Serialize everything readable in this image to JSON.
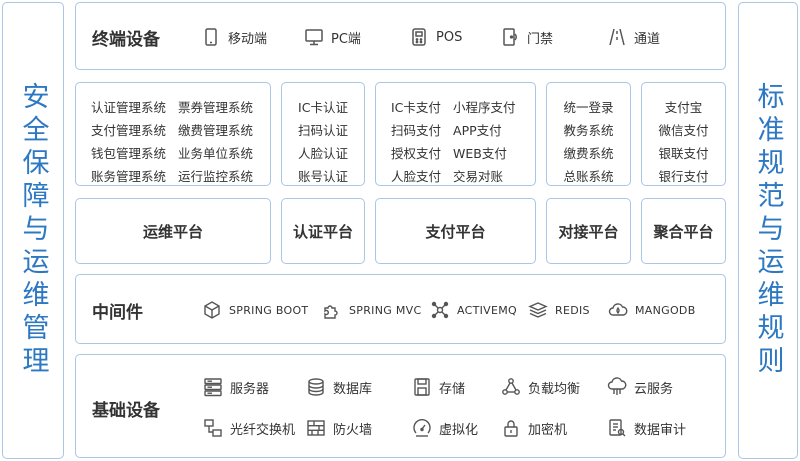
{
  "left_label": "安全保障与运维管理",
  "right_label": "标准规范与运维规则",
  "terminal": {
    "title": "终端设备",
    "items": [
      {
        "label": "移动端",
        "icon": "mobile-icon"
      },
      {
        "label": "PC端",
        "icon": "monitor-icon"
      },
      {
        "label": "POS",
        "icon": "pos-icon"
      },
      {
        "label": "门禁",
        "icon": "door-access-icon"
      },
      {
        "label": "通道",
        "icon": "passage-icon"
      }
    ]
  },
  "systems": {
    "mgmt": [
      "认证管理系统",
      "票券管理系统",
      "支付管理系统",
      "缴费管理系统",
      "钱包管理系统",
      "业务单位系统",
      "账务管理系统",
      "运行监控系统"
    ],
    "auth": [
      "IC卡认证",
      "扫码认证",
      "人脸认证",
      "账号认证"
    ],
    "pay": [
      "IC卡支付",
      "小程序支付",
      "扫码支付",
      "APP支付",
      "授权支付",
      "WEB支付",
      "人脸支付",
      "交易对账"
    ],
    "dock": [
      "统一登录",
      "教务系统",
      "缴费系统",
      "总账系统"
    ],
    "agg": [
      "支付宝",
      "微信支付",
      "银联支付",
      "银行支付"
    ]
  },
  "platforms": [
    "运维平台",
    "认证平台",
    "支付平台",
    "对接平台",
    "聚合平台"
  ],
  "middleware": {
    "title": "中间件",
    "items": [
      {
        "label": "SPRING BOOT",
        "icon": "cube-icon"
      },
      {
        "label": "SPRING MVC",
        "icon": "puzzle-icon"
      },
      {
        "label": "ACTIVEMQ",
        "icon": "network-nodes-icon"
      },
      {
        "label": "REDIS",
        "icon": "layers-icon"
      },
      {
        "label": "MANGODB",
        "icon": "cloud-leaf-icon"
      }
    ]
  },
  "infra": {
    "title": "基础设备",
    "items": [
      {
        "label": "服务器",
        "icon": "server-icon"
      },
      {
        "label": "数据库",
        "icon": "database-icon"
      },
      {
        "label": "存储",
        "icon": "storage-icon"
      },
      {
        "label": "负载均衡",
        "icon": "load-balance-icon"
      },
      {
        "label": "云服务",
        "icon": "cloud-service-icon"
      },
      {
        "label": "光纤交换机",
        "icon": "fiber-switch-icon"
      },
      {
        "label": "防火墙",
        "icon": "firewall-icon"
      },
      {
        "label": "虚拟化",
        "icon": "virtualization-icon"
      },
      {
        "label": "加密机",
        "icon": "encryption-icon"
      },
      {
        "label": "数据审计",
        "icon": "data-audit-icon"
      }
    ]
  }
}
